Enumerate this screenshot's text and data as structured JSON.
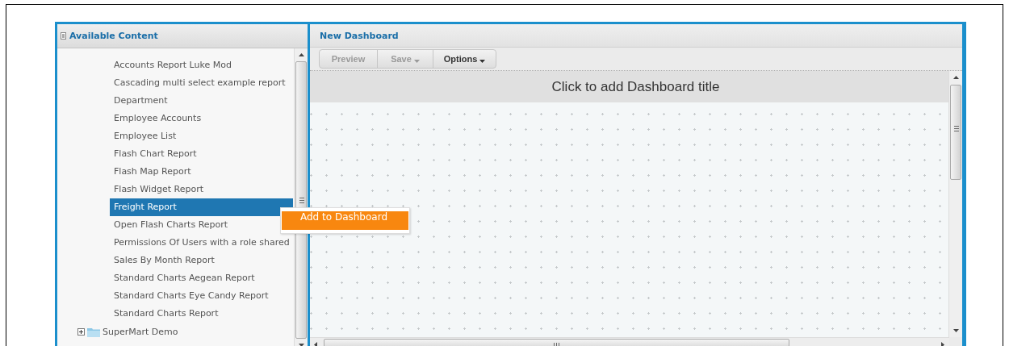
{
  "content_panel": {
    "title": "Available Content",
    "reports": [
      {
        "label": "Accounts Report Luke Mod",
        "selected": false
      },
      {
        "label": "Cascading multi select example report",
        "selected": false
      },
      {
        "label": "Department",
        "selected": false
      },
      {
        "label": "Employee Accounts",
        "selected": false
      },
      {
        "label": "Employee List",
        "selected": false
      },
      {
        "label": "Flash Chart Report",
        "selected": false
      },
      {
        "label": "Flash Map Report",
        "selected": false
      },
      {
        "label": "Flash Widget Report",
        "selected": false
      },
      {
        "label": "Freight Report",
        "selected": true
      },
      {
        "label": "Open Flash Charts Report",
        "selected": false
      },
      {
        "label": "Permissions Of Users with a role shared",
        "selected": false
      },
      {
        "label": "Sales By Month Report",
        "selected": false
      },
      {
        "label": "Standard Charts Aegean Report",
        "selected": false
      },
      {
        "label": "Standard Charts Eye Candy Report",
        "selected": false
      },
      {
        "label": "Standard Charts Report",
        "selected": false
      }
    ],
    "folders": [
      {
        "label": "SuperMart Demo",
        "expanded": false
      }
    ]
  },
  "dashboard": {
    "title": "New Dashboard",
    "toolbar": [
      {
        "label": "Preview",
        "disabled": true,
        "dropdown": false
      },
      {
        "label": "Save",
        "disabled": true,
        "dropdown": true
      },
      {
        "label": "Options",
        "disabled": false,
        "dropdown": true
      }
    ],
    "title_placeholder": "Click to add Dashboard title"
  },
  "context_menu": [
    {
      "label": "Add to Dashboard",
      "selected": true
    }
  ]
}
